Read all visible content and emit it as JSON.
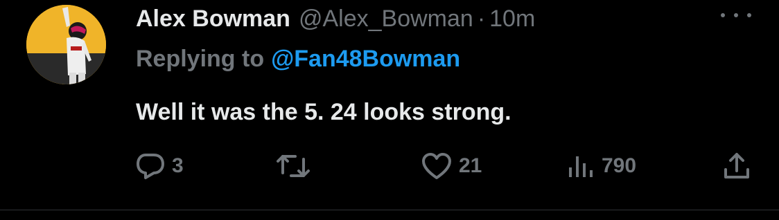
{
  "tweet": {
    "author_name": "Alex Bowman",
    "author_handle": "@Alex_Bowman",
    "separator": "·",
    "time": "10m",
    "replying_label": "Replying to",
    "replying_handle": "@Fan48Bowman",
    "text": "Well it was the 5. 24 looks strong.",
    "avatar_icon": "driver-avatar",
    "more_icon": "more-dots-icon"
  },
  "actions": {
    "reply": {
      "icon": "reply-icon",
      "count": "3"
    },
    "retweet": {
      "icon": "retweet-icon",
      "count": ""
    },
    "like": {
      "icon": "heart-icon",
      "count": "21"
    },
    "views": {
      "icon": "views-icon",
      "count": "790"
    },
    "share": {
      "icon": "share-icon",
      "count": ""
    }
  },
  "colors": {
    "background": "#000000",
    "text": "#e7e9ea",
    "secondary": "#71767b",
    "accent": "#1d9bf0",
    "avatar_bg": "#f0b429"
  }
}
